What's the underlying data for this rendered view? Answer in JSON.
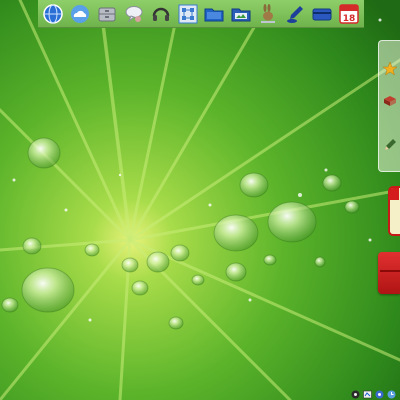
{
  "desktop": {
    "wallpaper": "green-leaf-water-drops"
  },
  "dock": {
    "icons": [
      {
        "name": "globe-icon",
        "color": "#2a6fd6"
      },
      {
        "name": "cloud-icon",
        "color": "#5aa0e8"
      },
      {
        "name": "drawer-icon",
        "color": "#9aa0a8"
      },
      {
        "name": "chat-icon",
        "color": "#e0e4ea"
      },
      {
        "name": "headset-icon",
        "color": "#333333"
      },
      {
        "name": "network-grid-icon",
        "color": "#3a7bd0"
      },
      {
        "name": "folder-icon",
        "color": "#1f63c4"
      },
      {
        "name": "photo-folder-icon",
        "color": "#2b5fb8"
      },
      {
        "name": "rabbit-icon",
        "color": "#8a6a3a"
      },
      {
        "name": "pen-icon",
        "color": "#1e3f9a"
      },
      {
        "name": "card-icon",
        "color": "#2a58c0"
      },
      {
        "name": "calendar-icon",
        "color": "#d42a2a",
        "text": "18"
      }
    ]
  },
  "side_panel": {
    "icons": [
      {
        "name": "star-icon",
        "color": "#f0b020"
      },
      {
        "name": "book-icon",
        "color": "#b03020"
      },
      {
        "name": "pencil-icon",
        "color": "#3a6a30"
      }
    ]
  },
  "tray": {
    "icons": [
      {
        "name": "tray-app-icon"
      },
      {
        "name": "tray-network-icon"
      },
      {
        "name": "tray-volume-icon"
      },
      {
        "name": "tray-clock-icon"
      }
    ]
  }
}
